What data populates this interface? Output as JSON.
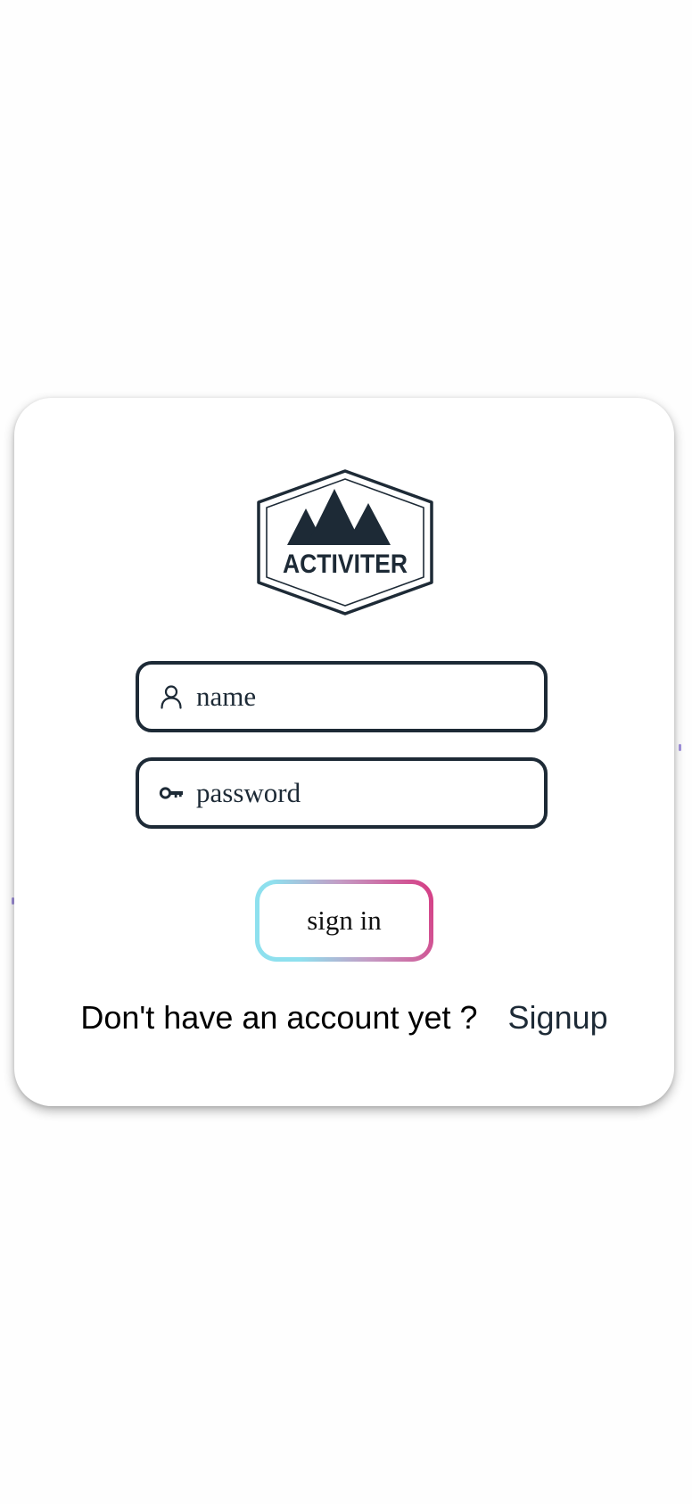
{
  "logo": {
    "text": "ACTIVITER",
    "icon": "mountain-hexagon-logo"
  },
  "form": {
    "name_field": {
      "placeholder": "name",
      "value": "",
      "icon": "user-icon"
    },
    "password_field": {
      "placeholder": "password",
      "value": "",
      "icon": "key-icon"
    },
    "submit_label": "sign in"
  },
  "footer": {
    "prompt": "Don't have an account yet ?",
    "signup_label": "Signup"
  },
  "colors": {
    "primary": "#1d2a36",
    "gradient_start": "#8ee0ee",
    "gradient_end": "#d63a82",
    "card_background": "#ffffff"
  }
}
